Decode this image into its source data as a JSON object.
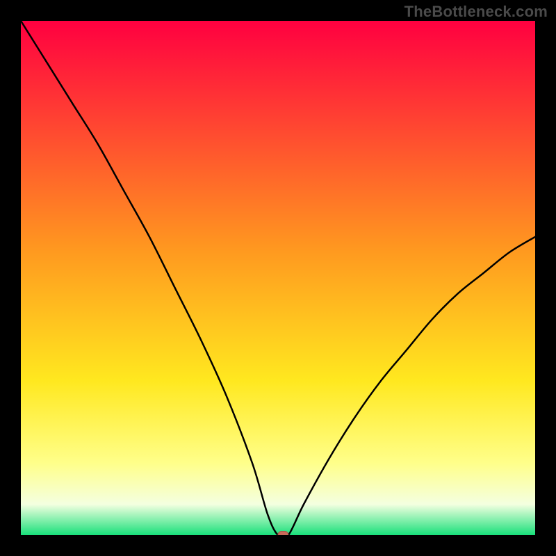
{
  "watermark": "TheBottleneck.com",
  "colors": {
    "frame_bg": "#000000",
    "watermark_text": "#4a4a4a",
    "curve": "#000000",
    "marker_fill": "#c96a5a",
    "marker_stroke": "#a85549",
    "gradient_stops": [
      {
        "offset": "0%",
        "color": "#ff0040"
      },
      {
        "offset": "45%",
        "color": "#ff9a1f"
      },
      {
        "offset": "70%",
        "color": "#ffe81f"
      },
      {
        "offset": "86%",
        "color": "#ffff8a"
      },
      {
        "offset": "94%",
        "color": "#f4ffe0"
      },
      {
        "offset": "100%",
        "color": "#18e07a"
      }
    ]
  },
  "chart_data": {
    "type": "line",
    "title": "",
    "xlabel": "",
    "ylabel": "",
    "xlim": [
      0,
      100
    ],
    "ylim": [
      0,
      100
    ],
    "grid": false,
    "legend": false,
    "series": [
      {
        "name": "bottleneck-curve",
        "x": [
          0,
          5,
          10,
          15,
          20,
          25,
          30,
          35,
          40,
          45,
          48,
          50,
          52,
          55,
          60,
          65,
          70,
          75,
          80,
          85,
          90,
          95,
          100
        ],
        "values": [
          100,
          92,
          84,
          76,
          67,
          58,
          48,
          38,
          27,
          14,
          4,
          0,
          0,
          6,
          15,
          23,
          30,
          36,
          42,
          47,
          51,
          55,
          58
        ]
      }
    ],
    "marker": {
      "x": 51,
      "y": 0,
      "width_pct": 2.0,
      "height_pct": 1.5
    }
  }
}
